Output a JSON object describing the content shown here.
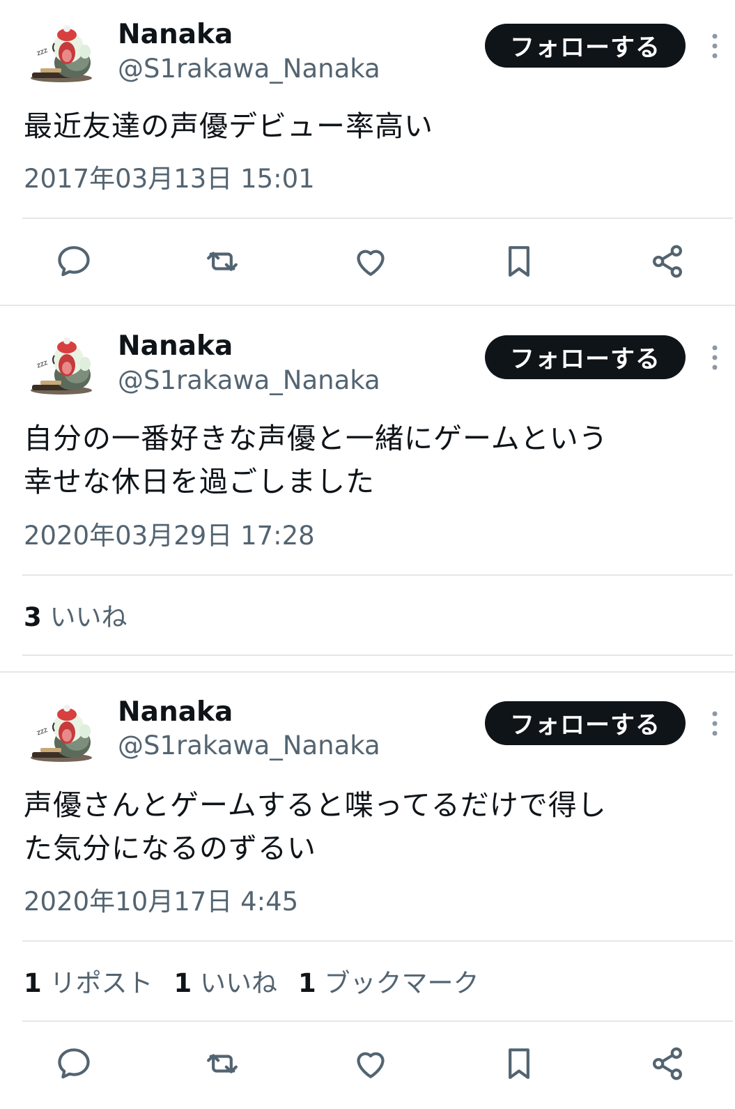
{
  "tweets": [
    {
      "name": "Nanaka",
      "handle": "@S1rakawa_Nanaka",
      "follow_label": "フォローする",
      "text": "最近友達の声優デビュー率高い",
      "time": "2017年03月13日 15:01"
    },
    {
      "name": "Nanaka",
      "handle": "@S1rakawa_Nanaka",
      "follow_label": "フォローする",
      "text_line1": "自分の一番好きな声優と一緒にゲームという",
      "text_line2": "幸せな休日を過ごしました",
      "time": "2020年03月29日 17:28",
      "stats": {
        "likes_count": "3",
        "likes_label": "いいね"
      }
    },
    {
      "name": "Nanaka",
      "handle": "@S1rakawa_Nanaka",
      "follow_label": "フォローする",
      "text_line1": "声優さんとゲームすると喋ってるだけで得し",
      "text_line2": "た気分になるのずるい",
      "time": "2020年10月17日 4:45",
      "stats": {
        "reposts_count": "1",
        "reposts_label": "リポスト",
        "likes_count": "1",
        "likes_label": "いいね",
        "bookmarks_count": "1",
        "bookmarks_label": "ブックマーク"
      }
    }
  ],
  "icons": [
    "reply-icon",
    "retweet-icon",
    "heart-icon",
    "bookmark-icon",
    "share-icon",
    "more-icon"
  ],
  "colors": {
    "primary_text": "#0f1419",
    "secondary_text": "#536471",
    "button_bg": "#0f1419",
    "divider": "#e3e7ea"
  }
}
